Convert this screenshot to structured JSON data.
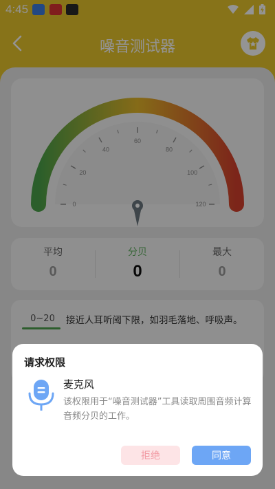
{
  "status_bar": {
    "time": "4:45"
  },
  "header": {
    "title": "噪音测试器"
  },
  "gauge": {
    "value": 0,
    "min": 0,
    "max": 120,
    "ticks": [
      "0",
      "20",
      "40",
      "60",
      "80",
      "100",
      "120"
    ],
    "arc_colors": [
      "#4aa34a",
      "#e6b82a",
      "#d6402e"
    ]
  },
  "stats": [
    {
      "label": "平均",
      "value": "0"
    },
    {
      "label": "分贝",
      "value": "0"
    },
    {
      "label": "最大",
      "value": "0"
    }
  ],
  "info": {
    "range": "0~20",
    "description": "接近人耳听阈下限，如羽毛落地、呼吸声。"
  },
  "dialog": {
    "title": "请求权限",
    "permission_name": "麦克风",
    "description": "该权限用于“噪音测试器”工具读取周围音频计算音频分贝的工作。",
    "deny_label": "拒绝",
    "allow_label": "同意"
  },
  "colors": {
    "header_bg": "#e9c62c",
    "accent_green": "#5eae5e",
    "allow_blue": "#6da6f5",
    "deny_pink": "#fde4e6"
  }
}
